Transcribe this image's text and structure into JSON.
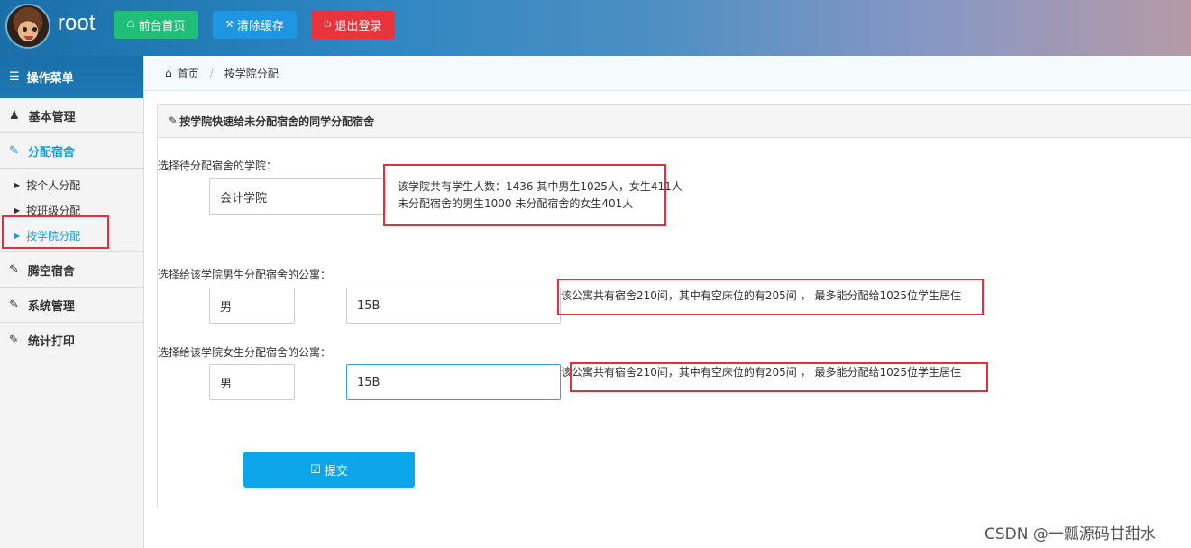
{
  "header": {
    "username": "root",
    "buttons": {
      "home": "前台首页",
      "clear_cache": "清除缓存",
      "logout": "退出登录"
    }
  },
  "sidebar": {
    "title": "操作菜单",
    "items": {
      "basic": "基本管理",
      "allocate": "分配宿舍",
      "vacate": "腾空宿舍",
      "system": "系统管理",
      "stats": "统计打印"
    },
    "allocate_sub": {
      "by_person": "按个人分配",
      "by_class": "按班级分配",
      "by_college": "按学院分配"
    }
  },
  "breadcrumb": {
    "home": "首页",
    "current": "按学院分配"
  },
  "panel": {
    "title": "按学院快速给未分配宿舍的同学分配宿舍",
    "college_label": "选择待分配宿舍的学院：",
    "college_value": "会计学院",
    "college_info_line1": "该学院共有学生人数：1436 其中男生1025人，女生411人",
    "college_info_line2": "未分配宿舍的男生1000 未分配宿舍的女生401人",
    "male_label": "选择给该学院男生分配宿舍的公寓：",
    "male_gender_value": "男",
    "male_building_value": "15B",
    "male_info": "该公寓共有宿舍210间，其中有空床位的有205间 ， 最多能分配给1025位学生居住",
    "female_label": "选择给该学院女生分配宿舍的公寓：",
    "female_gender_value": "男",
    "female_building_value": "15B",
    "female_info": "该公寓共有宿舍210间，其中有空床位的有205间 ， 最多能分配给1025位学生居住",
    "submit_label": "提交"
  },
  "watermark": "CSDN @一瓢源码甘甜水",
  "colors": {
    "accent": "#1a9ad6",
    "home_btn": "#1fbf7a",
    "clear_btn": "#1e96e1",
    "logout_btn": "#e9343c",
    "submit_btn": "#0da6ea",
    "highlight_box": "#e0313c"
  }
}
